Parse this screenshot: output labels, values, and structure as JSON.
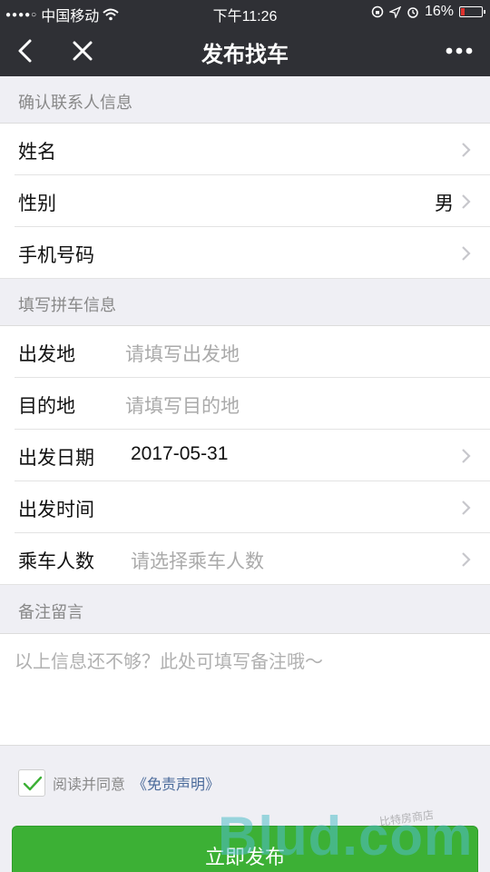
{
  "status_bar": {
    "signal_dots": "●●●●○",
    "carrier": "中国移动",
    "time": "下午11:26",
    "battery": "16%"
  },
  "nav": {
    "title": "发布找车"
  },
  "contact_section": {
    "header": "确认联系人信息",
    "rows": [
      {
        "label": "姓名",
        "value": ""
      },
      {
        "label": "性别",
        "value": "男"
      },
      {
        "label": "手机号码",
        "value": ""
      }
    ]
  },
  "trip_section": {
    "header": "填写拼车信息",
    "departure": {
      "label": "出发地",
      "placeholder": "请填写出发地"
    },
    "destination": {
      "label": "目的地",
      "placeholder": "请填写目的地"
    },
    "date": {
      "label": "出发日期",
      "value": "2017-05-31"
    },
    "time": {
      "label": "出发时间",
      "value": ""
    },
    "passengers": {
      "label": "乘车人数",
      "placeholder": "请选择乘车人数"
    }
  },
  "remarks_section": {
    "header": "备注留言",
    "placeholder": "以上信息还不够？此处可填写备注哦～"
  },
  "agreement": {
    "checked": true,
    "text": "阅读并同意",
    "link": "《免责声明》"
  },
  "submit": {
    "label": "立即发布"
  },
  "watermark": {
    "text": "Blud.com",
    "small": "比特房商店"
  },
  "colors": {
    "nav_bg": "#2f3035",
    "accent_green": "#3cb035",
    "link_blue": "#4a6a9a",
    "page_bg": "#efeff4"
  }
}
